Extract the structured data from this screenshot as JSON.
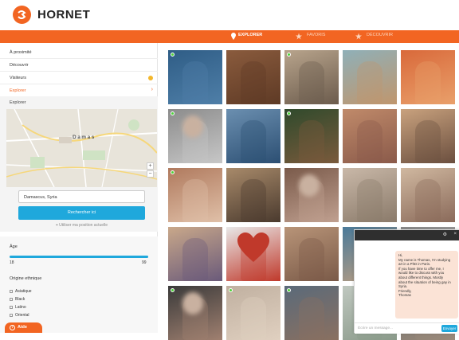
{
  "brand": {
    "name": "HORNET",
    "color": "#f26522"
  },
  "topnav": {
    "items": [
      {
        "label": "EXPLORER",
        "icon": "location-pin-icon",
        "active": true
      },
      {
        "label": "FAVORIS",
        "icon": "star-icon",
        "active": false
      },
      {
        "label": "DÉCOUVRIR",
        "icon": "star-icon",
        "active": false
      }
    ]
  },
  "sidebar": {
    "items": [
      {
        "label": "À proximité"
      },
      {
        "label": "Découvrir"
      },
      {
        "label": "Visiteurs",
        "badge": "yellow-dot"
      },
      {
        "label": "Explorer",
        "selected": true
      }
    ],
    "explorer_label": "Explorer",
    "map": {
      "city_label": "Damas"
    },
    "city_value": "Damascus, Syria",
    "search_label": "Rechercher ici",
    "use_position_label": "Utiliser ma position actuelle",
    "age": {
      "label": "Âge",
      "min": "18",
      "max": "99"
    },
    "ethnicity": {
      "label": "Origine ethnique",
      "options": [
        "Asiatique",
        "Black",
        "Latino",
        "Oriental"
      ]
    },
    "help_label": "Aide"
  },
  "grid": {
    "online_tiles": [
      0,
      2,
      5,
      7,
      10,
      20,
      21,
      22
    ]
  },
  "chat": {
    "message_lines": [
      "Hi,",
      "My name is Thomas, I'm studying",
      "art in a PhD in Paris.",
      "If you have time to offer me, I",
      "would like to discuss with you",
      "about different things. Mostly",
      "about the situation of being gay in",
      "Syria.",
      "Friendly,",
      "Thomas"
    ],
    "time": "2 minutes ago",
    "input_placeholder": "Écrire un message...",
    "send_label": "Envoyer"
  }
}
